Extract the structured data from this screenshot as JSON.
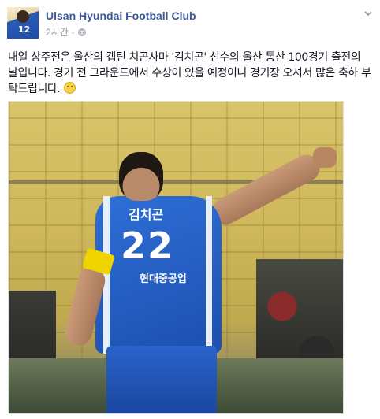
{
  "post": {
    "page_name": "Ulsan Hyundai Football Club",
    "timestamp": "2시간",
    "text": "내일 상주전은 울산의 캡틴 치곤사마 '김치곤' 선수의 울산 통산 100경기 출전의 날입니다. 경기 전 그라운드에서 수상이 있을 예정이니 경기장 오셔서 많은 축하 부탁드립니다.",
    "emoji": "smile-emoji"
  },
  "avatar": {
    "jersey_number": "12"
  },
  "photo": {
    "jersey_number": "22",
    "jersey_name": "김치곤",
    "jersey_sponsor": "현대중공업"
  },
  "icons": {
    "privacy": "globe-icon",
    "menu": "chevron-down-icon"
  },
  "colors": {
    "link": "#3b5998",
    "meta": "#9197a3",
    "jersey": "#1f55c0",
    "armband": "#f0d400"
  }
}
